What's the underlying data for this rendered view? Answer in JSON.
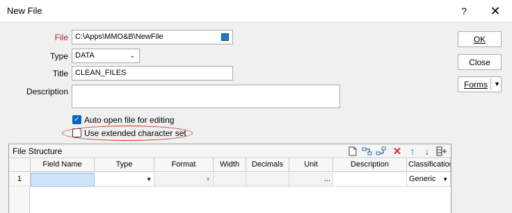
{
  "window": {
    "title": "New File",
    "help_glyph": "?",
    "close_glyph": "✕"
  },
  "form": {
    "file_label": "File",
    "file_value": "C:\\Apps\\MMO&B\\NewFile",
    "type_label": "Type",
    "type_value": "DATA",
    "title_label": "Title",
    "title_value": "CLEAN_FILES",
    "description_label": "Description",
    "description_value": "",
    "auto_open_label": "Auto open file for editing",
    "auto_open_checked": true,
    "extended_charset_label": "Use extended character set",
    "extended_charset_checked": false
  },
  "buttons": {
    "ok": "OK",
    "close": "Close",
    "forms": "Forms"
  },
  "file_structure": {
    "title": "File Structure",
    "tools": [
      "new-file-icon",
      "insert-field-icon",
      "append-field-icon",
      "delete-icon",
      "move-up-icon",
      "move-down-icon",
      "add-columns-icon"
    ],
    "columns": [
      "",
      "Field Name",
      "Type",
      "Format",
      "Width",
      "Decimals",
      "Unit",
      "Description",
      "Classification"
    ],
    "rows": [
      {
        "num": "1",
        "field_name": "",
        "type": "",
        "format": "",
        "width": "",
        "decimals": "",
        "unit": "...",
        "description": "",
        "classification": "Generic"
      }
    ]
  },
  "colors": {
    "accent": "#0067c0",
    "required_label": "#a52a2a",
    "annotation_ellipse": "#c0392b",
    "delete_icon": "#d32f2f",
    "arrow_icons": "#1e6fc8",
    "selected_cell": "#cfe3f7"
  }
}
